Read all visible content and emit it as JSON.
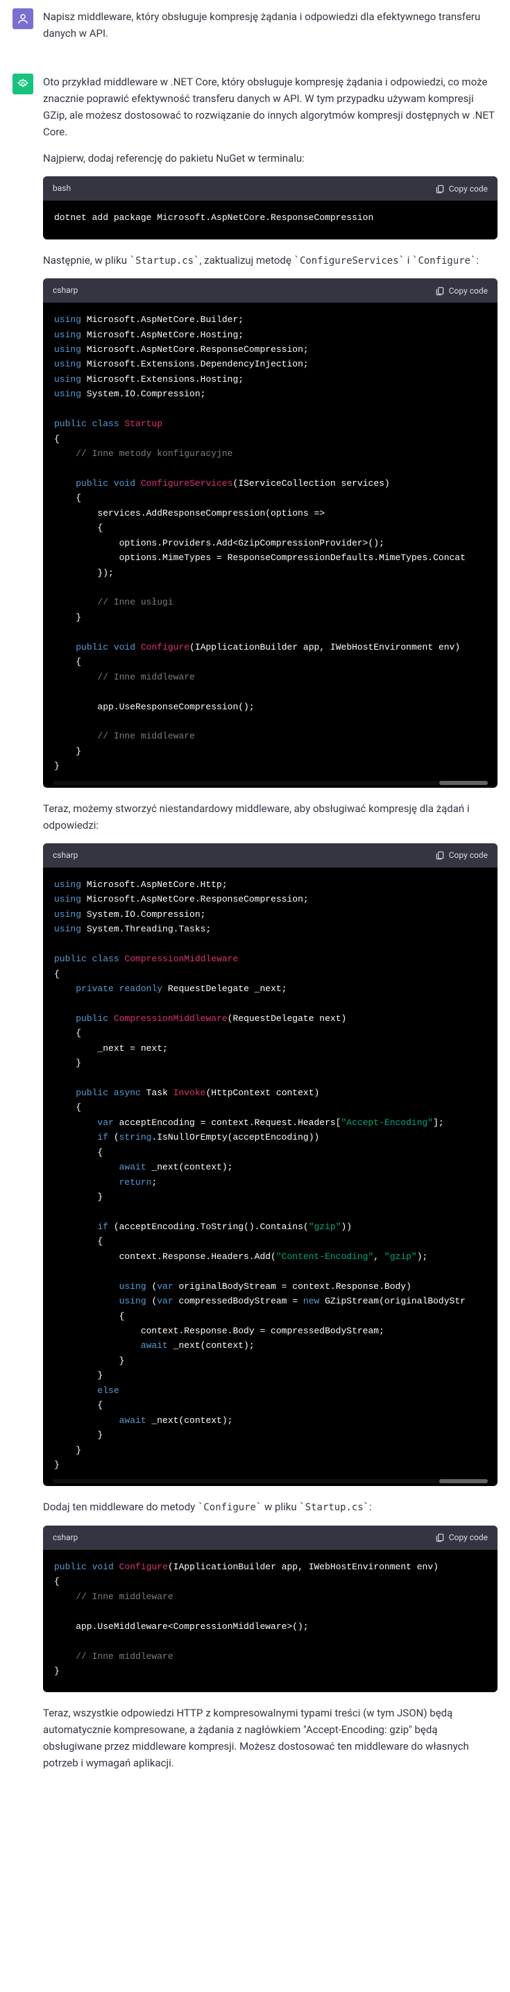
{
  "user_prompt": "Napisz middleware, który obsługuje kompresję żądania i odpowiedzi dla efektywnego transferu danych w API.",
  "assistant": {
    "p1": "Oto przykład middleware w .NET Core, który obsługuje kompresję żądania i odpowiedzi, co może znacznie poprawić efektywność transferu danych w API. W tym przypadku używam kompresji GZip, ale możesz dostosować to rozwiązanie do innych algorytmów kompresji dostępnych w .NET Core.",
    "p2": "Najpierw, dodaj referencję do pakietu NuGet w terminalu:",
    "p3_a": "Następnie, w pliku ",
    "p3_b": "`Startup.cs`",
    "p3_c": ", zaktualizuj metodę ",
    "p3_d": "`ConfigureServices`",
    "p3_e": " i ",
    "p3_f": "`Configure`",
    "p3_g": ":",
    "p4": "Teraz, możemy stworzyć niestandardowy middleware, aby obsługiwać kompresję dla żądań i odpowiedzi:",
    "p5_a": "Dodaj ten middleware do metody ",
    "p5_b": "`Configure`",
    "p5_c": " w pliku ",
    "p5_d": "`Startup.cs`",
    "p5_e": ":",
    "p6": "Teraz, wszystkie odpowiedzi HTTP z kompresowalnymi typami treści (w tym JSON) będą automatycznie kompresowane, a żądania z nagłówkiem \"Accept-Encoding: gzip\" będą obsługiwane przez middleware kompresji. Możesz dostosować ten middleware do własnych potrzeb i wymagań aplikacji."
  },
  "code": {
    "lang_bash": "bash",
    "lang_csharp": "csharp",
    "copy_label": "Copy code",
    "bash1": "dotnet add package Microsoft.AspNetCore.ResponseCompression",
    "cs1": {
      "u1": "Microsoft.AspNetCore.Builder;",
      "u2": "Microsoft.AspNetCore.Hosting;",
      "u3": "Microsoft.AspNetCore.ResponseCompression;",
      "u4": "Microsoft.Extensions.DependencyInjection;",
      "u5": "Microsoft.Extensions.Hosting;",
      "u6": "System.IO.Compression;",
      "cls": "Startup",
      "cmt1": "// Inne metody konfiguracyjne",
      "m1": "ConfigureServices",
      "m1_sig": "(IServiceCollection services)",
      "l1": "        services.AddResponseCompression(options =>",
      "l2": "            options.Providers.Add<GzipCompressionProvider>();",
      "l3": "            options.MimeTypes = ResponseCompressionDefaults.MimeTypes.Concat",
      "cmt2": "// Inne usługi",
      "m2": "Configure",
      "m2_sig": "(IApplicationBuilder app, IWebHostEnvironment env)",
      "cmt3": "// Inne middleware",
      "l4": "        app.UseResponseCompression();",
      "cmt4": "// Inne middleware"
    },
    "cs2": {
      "u1": "Microsoft.AspNetCore.Http;",
      "u2": "Microsoft.AspNetCore.ResponseCompression;",
      "u3": "System.IO.Compression;",
      "u4": "System.Threading.Tasks;",
      "cls": "CompressionMiddleware",
      "fld": " RequestDelegate _next;",
      "ctor": "CompressionMiddleware",
      "ctor_sig": "(RequestDelegate next)",
      "ctor_body": "        _next = next;",
      "m1": "Invoke",
      "m1_sig": "(HttpContext context)",
      "l1a": " acceptEncoding = context.Request.Headers[",
      "l1b": "\"Accept-Encoding\"",
      "l1c": "];",
      "l2a": ".IsNullOrEmpty(acceptEncoding))",
      "l3": " _next(context);",
      "l4a": " (acceptEncoding.ToString().Contains(",
      "l4b": "\"gzip\"",
      "l4c": "))",
      "l5a": "            context.Response.Headers.Add(",
      "l5b": "\"Content-Encoding\"",
      "l5c": ", ",
      "l5d": "\"gzip\"",
      "l5e": ");",
      "l6": " originalBodyStream = context.Response.Body)",
      "l7a": " compressedBodyStream = ",
      "l7b": " GZipStream(originalBodyStr",
      "l8": "                context.Response.Body = compressedBodyStream;",
      "l9": " _next(context);",
      "l10": " _next(context);"
    },
    "cs3": {
      "m": "Configure",
      "sig": "(IApplicationBuilder app, IWebHostEnvironment env)",
      "cmt1": "// Inne middleware",
      "l1": "    app.UseMiddleware<CompressionMiddleware>();",
      "cmt2": "// Inne middleware"
    }
  }
}
